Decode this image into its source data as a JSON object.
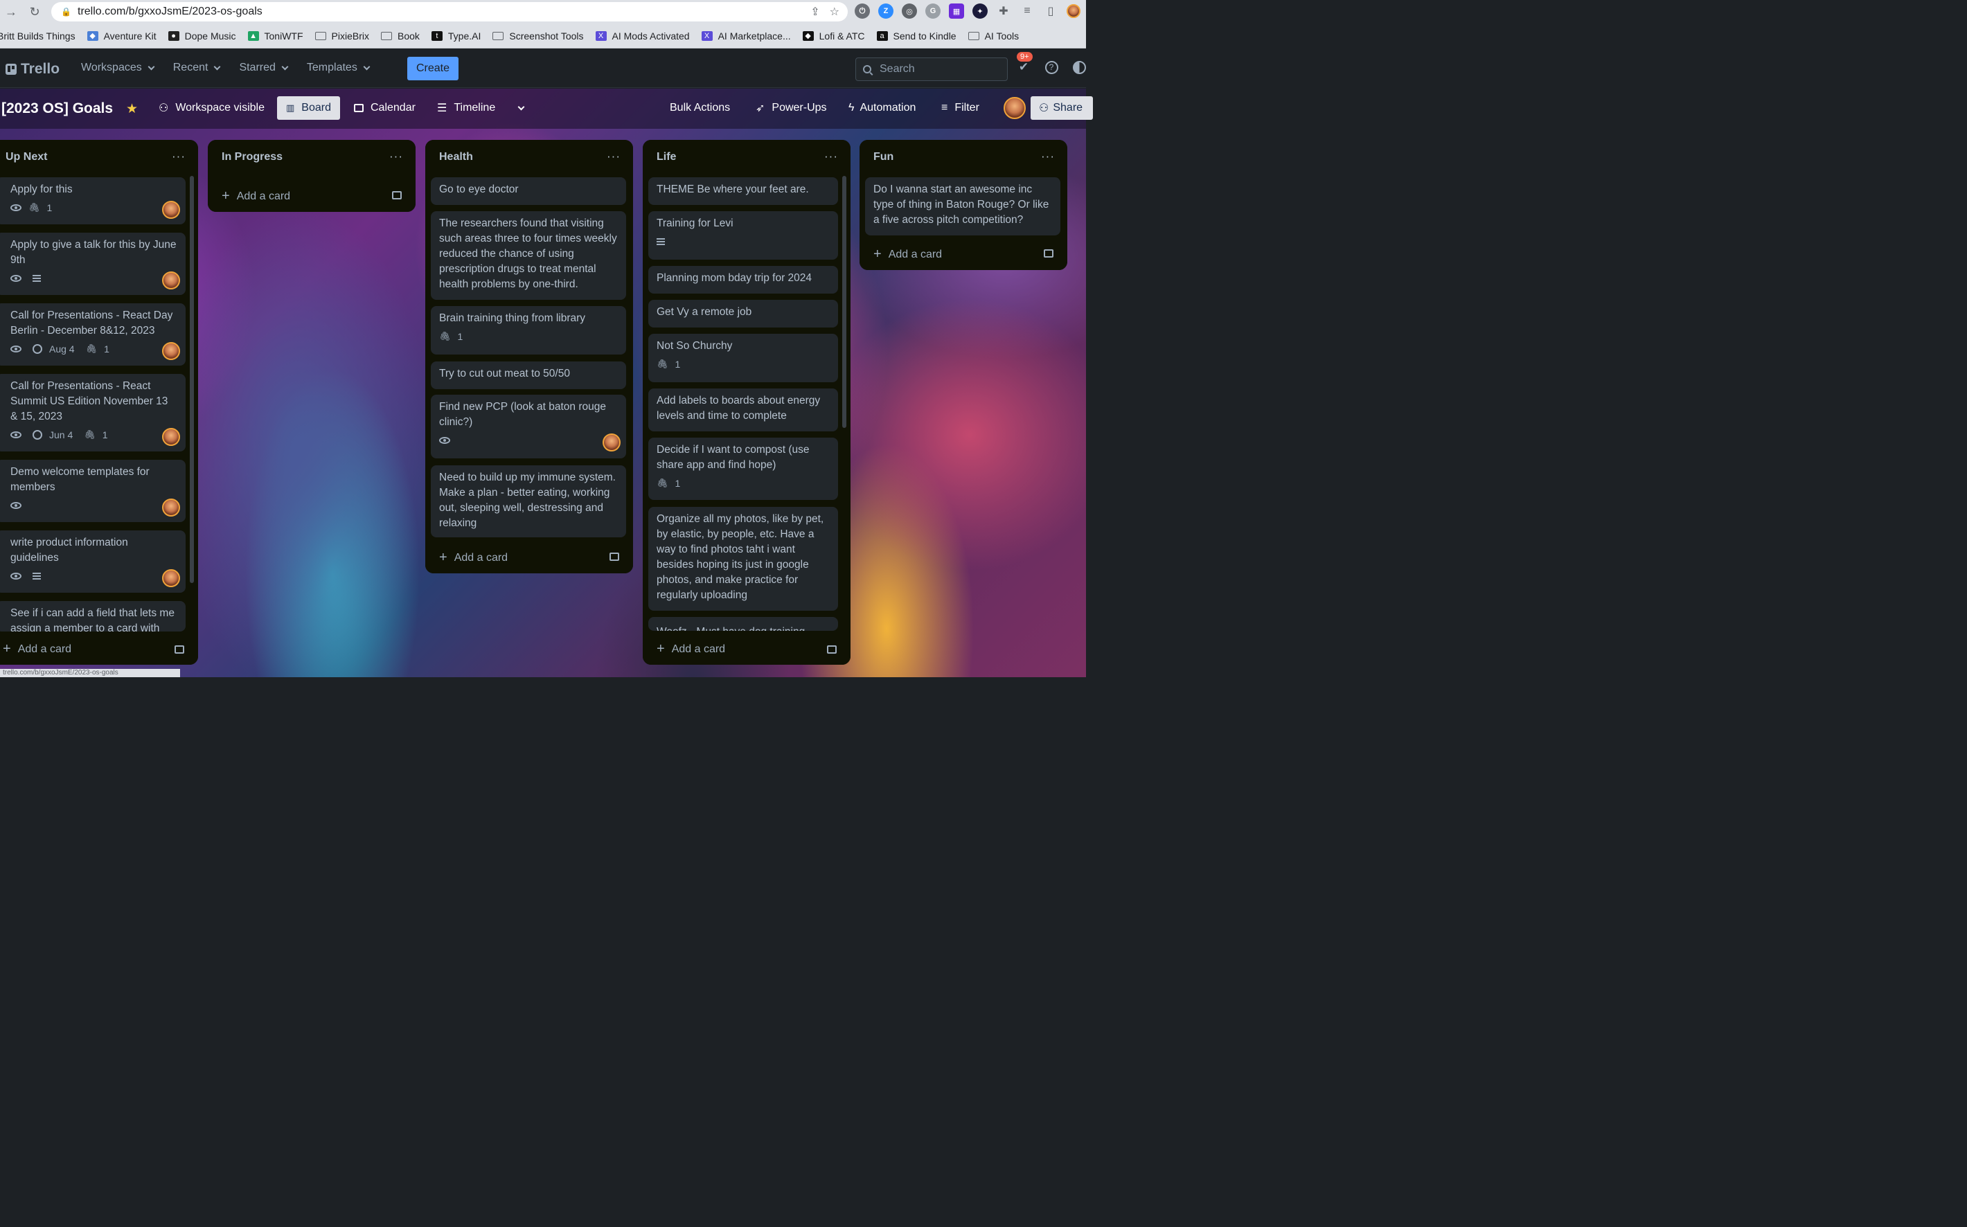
{
  "browser": {
    "url": "trello.com/b/gxxoJsmE/2023-os-goals",
    "bookmarks": [
      {
        "label": "Britt Builds Things",
        "icon": "none"
      },
      {
        "label": "Aventure Kit",
        "icon": "app",
        "color": "#4a7fd6"
      },
      {
        "label": "Dope Music",
        "icon": "disc",
        "color": "#222"
      },
      {
        "label": "ToniWTF",
        "icon": "drive",
        "color": "#1fa463"
      },
      {
        "label": "PixieBrix",
        "icon": "folder"
      },
      {
        "label": "Book",
        "icon": "folder"
      },
      {
        "label": "Type.AI",
        "icon": "t",
        "color": "#111"
      },
      {
        "label": "Screenshot Tools",
        "icon": "folder"
      },
      {
        "label": "AI Mods Activated",
        "icon": "x",
        "color": "#5b4cd8"
      },
      {
        "label": "AI Marketplace...",
        "icon": "x",
        "color": "#5b4cd8"
      },
      {
        "label": "Lofi & ATC",
        "icon": "app",
        "color": "#111"
      },
      {
        "label": "Send to Kindle",
        "icon": "a",
        "color": "#111"
      },
      {
        "label": "AI Tools",
        "icon": "folder"
      }
    ],
    "status_url": "trello.com/b/gxxoJsmE/2023-os-goals"
  },
  "header": {
    "brand": "Trello",
    "nav": [
      "Workspaces",
      "Recent",
      "Starred",
      "Templates"
    ],
    "create": "Create",
    "search_placeholder": "Search",
    "notif_count": "9+"
  },
  "board": {
    "title": "[2023 OS] Goals",
    "visibility": "Workspace visible",
    "views": [
      "Board",
      "Calendar",
      "Timeline"
    ],
    "actions": [
      "Bulk Actions",
      "Power-Ups",
      "Automation",
      "Filter"
    ],
    "share": "Share"
  },
  "lists": {
    "up_next": {
      "title": "Up Next",
      "add": "Add a card",
      "cards": [
        {
          "text": "Apply for this",
          "attach": "1"
        },
        {
          "text": "Apply to give a talk for this by June 9th"
        },
        {
          "text": "Call for Presentations - React Day Berlin - December 8&12, 2023",
          "date": "Aug 4",
          "attach": "1"
        },
        {
          "text": "Call for Presentations - React Summit US Edition November 13 & 15, 2023",
          "date": "Jun 4",
          "attach": "1"
        },
        {
          "text": "Demo welcome templates for members"
        },
        {
          "text": "write product information guidelines"
        },
        {
          "text": "See if i can add a field that lets me assign a member to a card with"
        }
      ]
    },
    "in_progress": {
      "title": "In Progress",
      "add": "Add a card"
    },
    "health": {
      "title": "Health",
      "add": "Add a card",
      "cards": [
        {
          "text": "Go to eye doctor"
        },
        {
          "text": "The researchers found that visiting such areas three to four times weekly reduced the chance of using prescription drugs to treat mental health problems by one-third."
        },
        {
          "text": "Brain training thing from library",
          "attach": "1"
        },
        {
          "text": "Try to cut out meat to 50/50"
        },
        {
          "text": "Find new PCP (look at baton rouge clinic?)"
        },
        {
          "text": "Need to build up my immune system. Make a plan - better eating, working out, sleeping well, destressing and relaxing"
        }
      ]
    },
    "life": {
      "title": "Life",
      "add": "Add a card",
      "cards": [
        {
          "text": "THEME Be where your feet are."
        },
        {
          "text": "Training for Levi"
        },
        {
          "text": "Planning mom bday trip for 2024"
        },
        {
          "text": "Get Vy a remote job"
        },
        {
          "text": "Not So Churchy",
          "attach": "1"
        },
        {
          "text": "Add labels to boards about energy levels and time to complete"
        },
        {
          "text": "Decide if I want to compost (use share app and find hope)",
          "attach": "1"
        },
        {
          "text": "Organize all my photos, like by pet, by elastic, by people, etc. Have a way to find photos taht i want besides hoping its just in google photos, and make practice for regularly uploading"
        },
        {
          "text": "Woofz - Must have dog training"
        }
      ]
    },
    "fun": {
      "title": "Fun",
      "add": "Add a card",
      "cards": [
        {
          "text": "Do I wanna start an awesome inc type of thing in Baton Rouge? Or like a five across pitch competition?"
        }
      ]
    }
  }
}
